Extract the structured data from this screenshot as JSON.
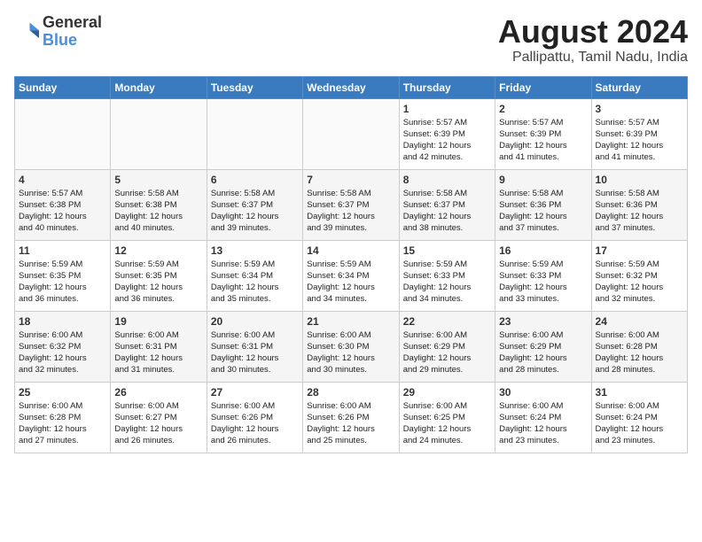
{
  "header": {
    "logo_general": "General",
    "logo_blue": "Blue",
    "title": "August 2024",
    "subtitle": "Pallipattu, Tamil Nadu, India"
  },
  "days_of_week": [
    "Sunday",
    "Monday",
    "Tuesday",
    "Wednesday",
    "Thursday",
    "Friday",
    "Saturday"
  ],
  "weeks": [
    [
      {
        "num": "",
        "info": ""
      },
      {
        "num": "",
        "info": ""
      },
      {
        "num": "",
        "info": ""
      },
      {
        "num": "",
        "info": ""
      },
      {
        "num": "1",
        "info": "Sunrise: 5:57 AM\nSunset: 6:39 PM\nDaylight: 12 hours\nand 42 minutes."
      },
      {
        "num": "2",
        "info": "Sunrise: 5:57 AM\nSunset: 6:39 PM\nDaylight: 12 hours\nand 41 minutes."
      },
      {
        "num": "3",
        "info": "Sunrise: 5:57 AM\nSunset: 6:39 PM\nDaylight: 12 hours\nand 41 minutes."
      }
    ],
    [
      {
        "num": "4",
        "info": "Sunrise: 5:57 AM\nSunset: 6:38 PM\nDaylight: 12 hours\nand 40 minutes."
      },
      {
        "num": "5",
        "info": "Sunrise: 5:58 AM\nSunset: 6:38 PM\nDaylight: 12 hours\nand 40 minutes."
      },
      {
        "num": "6",
        "info": "Sunrise: 5:58 AM\nSunset: 6:37 PM\nDaylight: 12 hours\nand 39 minutes."
      },
      {
        "num": "7",
        "info": "Sunrise: 5:58 AM\nSunset: 6:37 PM\nDaylight: 12 hours\nand 39 minutes."
      },
      {
        "num": "8",
        "info": "Sunrise: 5:58 AM\nSunset: 6:37 PM\nDaylight: 12 hours\nand 38 minutes."
      },
      {
        "num": "9",
        "info": "Sunrise: 5:58 AM\nSunset: 6:36 PM\nDaylight: 12 hours\nand 37 minutes."
      },
      {
        "num": "10",
        "info": "Sunrise: 5:58 AM\nSunset: 6:36 PM\nDaylight: 12 hours\nand 37 minutes."
      }
    ],
    [
      {
        "num": "11",
        "info": "Sunrise: 5:59 AM\nSunset: 6:35 PM\nDaylight: 12 hours\nand 36 minutes."
      },
      {
        "num": "12",
        "info": "Sunrise: 5:59 AM\nSunset: 6:35 PM\nDaylight: 12 hours\nand 36 minutes."
      },
      {
        "num": "13",
        "info": "Sunrise: 5:59 AM\nSunset: 6:34 PM\nDaylight: 12 hours\nand 35 minutes."
      },
      {
        "num": "14",
        "info": "Sunrise: 5:59 AM\nSunset: 6:34 PM\nDaylight: 12 hours\nand 34 minutes."
      },
      {
        "num": "15",
        "info": "Sunrise: 5:59 AM\nSunset: 6:33 PM\nDaylight: 12 hours\nand 34 minutes."
      },
      {
        "num": "16",
        "info": "Sunrise: 5:59 AM\nSunset: 6:33 PM\nDaylight: 12 hours\nand 33 minutes."
      },
      {
        "num": "17",
        "info": "Sunrise: 5:59 AM\nSunset: 6:32 PM\nDaylight: 12 hours\nand 32 minutes."
      }
    ],
    [
      {
        "num": "18",
        "info": "Sunrise: 6:00 AM\nSunset: 6:32 PM\nDaylight: 12 hours\nand 32 minutes."
      },
      {
        "num": "19",
        "info": "Sunrise: 6:00 AM\nSunset: 6:31 PM\nDaylight: 12 hours\nand 31 minutes."
      },
      {
        "num": "20",
        "info": "Sunrise: 6:00 AM\nSunset: 6:31 PM\nDaylight: 12 hours\nand 30 minutes."
      },
      {
        "num": "21",
        "info": "Sunrise: 6:00 AM\nSunset: 6:30 PM\nDaylight: 12 hours\nand 30 minutes."
      },
      {
        "num": "22",
        "info": "Sunrise: 6:00 AM\nSunset: 6:29 PM\nDaylight: 12 hours\nand 29 minutes."
      },
      {
        "num": "23",
        "info": "Sunrise: 6:00 AM\nSunset: 6:29 PM\nDaylight: 12 hours\nand 28 minutes."
      },
      {
        "num": "24",
        "info": "Sunrise: 6:00 AM\nSunset: 6:28 PM\nDaylight: 12 hours\nand 28 minutes."
      }
    ],
    [
      {
        "num": "25",
        "info": "Sunrise: 6:00 AM\nSunset: 6:28 PM\nDaylight: 12 hours\nand 27 minutes."
      },
      {
        "num": "26",
        "info": "Sunrise: 6:00 AM\nSunset: 6:27 PM\nDaylight: 12 hours\nand 26 minutes."
      },
      {
        "num": "27",
        "info": "Sunrise: 6:00 AM\nSunset: 6:26 PM\nDaylight: 12 hours\nand 26 minutes."
      },
      {
        "num": "28",
        "info": "Sunrise: 6:00 AM\nSunset: 6:26 PM\nDaylight: 12 hours\nand 25 minutes."
      },
      {
        "num": "29",
        "info": "Sunrise: 6:00 AM\nSunset: 6:25 PM\nDaylight: 12 hours\nand 24 minutes."
      },
      {
        "num": "30",
        "info": "Sunrise: 6:00 AM\nSunset: 6:24 PM\nDaylight: 12 hours\nand 23 minutes."
      },
      {
        "num": "31",
        "info": "Sunrise: 6:00 AM\nSunset: 6:24 PM\nDaylight: 12 hours\nand 23 minutes."
      }
    ]
  ]
}
